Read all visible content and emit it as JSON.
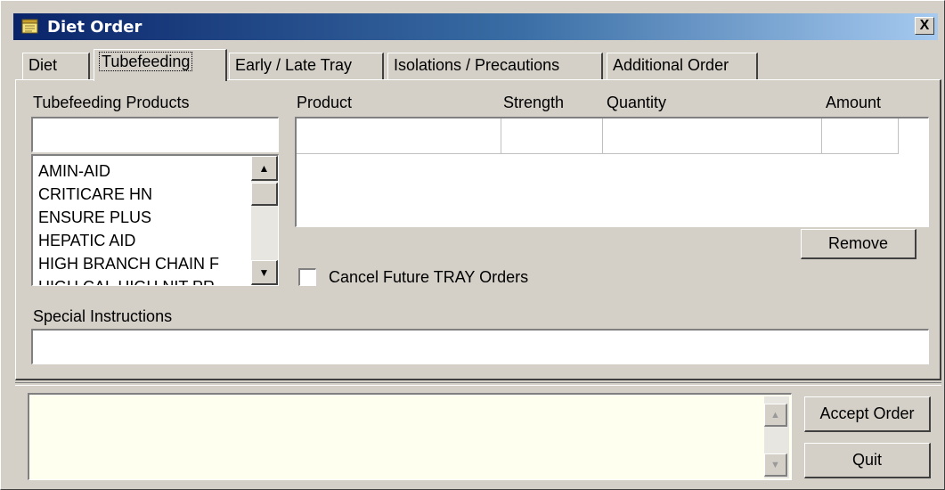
{
  "window": {
    "title": "Diet Order",
    "close_label": "X"
  },
  "tabs": [
    {
      "label": "Diet",
      "active": false
    },
    {
      "label": "Tubefeeding",
      "active": true
    },
    {
      "label": "Early / Late Tray",
      "active": false
    },
    {
      "label": "Isolations / Precautions",
      "active": false
    },
    {
      "label": "Additional Order",
      "active": false
    }
  ],
  "tubefeeding": {
    "products_label": "Tubefeeding Products",
    "search_value": "",
    "products": [
      "AMIN-AID",
      "CRITICARE HN",
      "ENSURE PLUS",
      "HEPATIC AID",
      "HIGH BRANCH CHAIN F",
      "HIGH CAL HIGH NIT PR"
    ],
    "grid_columns": [
      "Product",
      "Strength",
      "Quantity",
      "Amount"
    ],
    "remove_label": "Remove",
    "cancel_future_label": "Cancel Future TRAY Orders",
    "cancel_future_checked": false,
    "special_instructions_label": "Special Instructions",
    "special_instructions_value": ""
  },
  "footer": {
    "memo_value": "",
    "accept_label": "Accept Order",
    "quit_label": "Quit"
  },
  "icons": {
    "app": "notepad-icon",
    "scroll_up": "arrow-up-icon",
    "scroll_down": "arrow-down-icon"
  },
  "colors": {
    "title_gradient_start": "#0a246a",
    "title_gradient_end": "#a6caf0",
    "face": "#d4d0c8",
    "memo_bg": "#fffff0"
  }
}
